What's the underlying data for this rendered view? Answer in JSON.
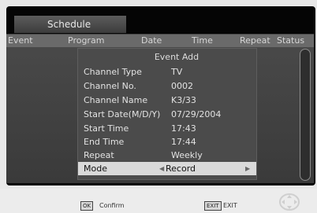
{
  "tab": {
    "label": "Schedule"
  },
  "columns": [
    "Event",
    "Program",
    "Date",
    "Time",
    "Repeat",
    "Status"
  ],
  "dialog": {
    "title": "Event Add",
    "fields": [
      {
        "label": "Channel Type",
        "value": "TV"
      },
      {
        "label": "Channel No.",
        "value": "0002"
      },
      {
        "label": "Channel Name",
        "value": "K3/33"
      },
      {
        "label": "Start Date(M/D/Y)",
        "value": "07/29/2004"
      },
      {
        "label": "Start Time",
        "value": "17:43"
      },
      {
        "label": "End Time",
        "value": "17:44"
      },
      {
        "label": "Repeat",
        "value": "Weekly"
      },
      {
        "label": "Mode",
        "value": "Record",
        "selected": true
      }
    ]
  },
  "footer": {
    "ok_key": "OK",
    "ok_hint": "Confirm",
    "exit_key": "EXIT",
    "exit_hint": "EXIT",
    "nav_icon": "dpad-icon"
  }
}
